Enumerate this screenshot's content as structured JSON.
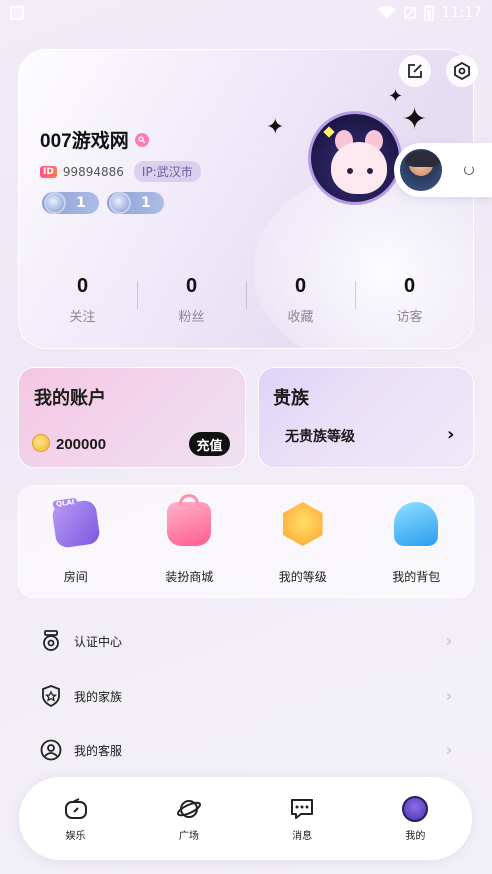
{
  "status_bar": {
    "time": "11:17"
  },
  "profile": {
    "username": "007游戏网",
    "id_label": "ID",
    "id_value": "99894886",
    "ip": "IP:武汉市",
    "medals": [
      {
        "value": "1"
      },
      {
        "value": "1"
      }
    ],
    "stats": [
      {
        "value": "0",
        "label": "关注"
      },
      {
        "value": "0",
        "label": "粉丝"
      },
      {
        "value": "0",
        "label": "收藏"
      },
      {
        "value": "0",
        "label": "访客"
      }
    ]
  },
  "account": {
    "title": "我的账户",
    "balance": "200000",
    "recharge_label": "充值"
  },
  "noble": {
    "title": "贵族",
    "level": "无贵族等级"
  },
  "grid": [
    {
      "label": "房间",
      "icon": "room-icon",
      "tag": "QLAI"
    },
    {
      "label": "装扮商城",
      "icon": "shop-bag-icon"
    },
    {
      "label": "我的等级",
      "icon": "level-badge-icon"
    },
    {
      "label": "我的背包",
      "icon": "backpack-icon"
    }
  ],
  "list": [
    {
      "label": "认证中心",
      "icon": "certification-icon"
    },
    {
      "label": "我的家族",
      "icon": "family-shield-icon"
    },
    {
      "label": "我的客服",
      "icon": "customer-service-icon"
    }
  ],
  "nav": [
    {
      "label": "娱乐",
      "icon": "entertainment-icon"
    },
    {
      "label": "广场",
      "icon": "planet-icon"
    },
    {
      "label": "消息",
      "icon": "chat-icon"
    },
    {
      "label": "我的",
      "icon": "me-avatar-icon"
    }
  ]
}
